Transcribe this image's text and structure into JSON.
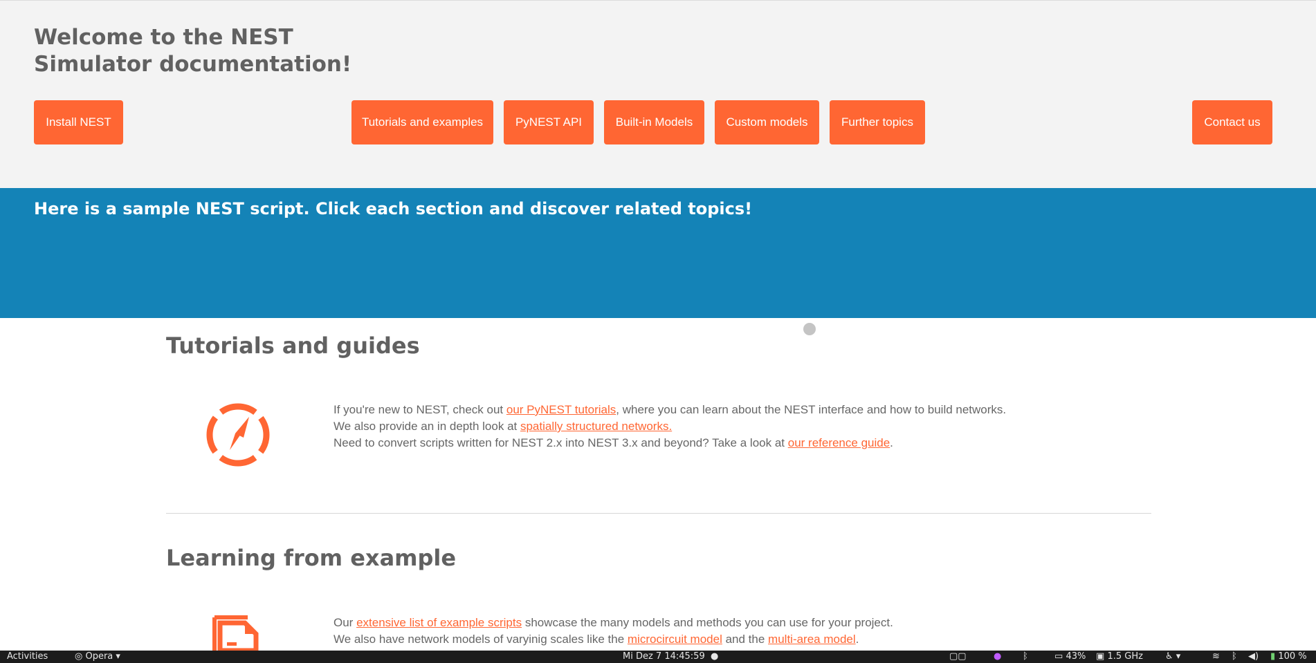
{
  "header": {
    "title": "Welcome to the NEST Simulator documentation!",
    "buttons": {
      "install": "Install NEST",
      "tutorials": "Tutorials and examples",
      "pynest": "PyNEST API",
      "builtin": "Built-in Models",
      "custom": "Custom models",
      "further": "Further topics",
      "contact": "Contact us"
    },
    "accent_color": "#ff6633"
  },
  "banner": {
    "text": "Here is a sample NEST script. Click each section and discover related topics!",
    "color": "#1483b7"
  },
  "sections": {
    "tutorials": {
      "title": "Tutorials and guides",
      "icon": "compass-icon",
      "line1": {
        "pre": "If you're new to NEST, check out ",
        "link": "our PyNEST tutorials",
        "post": ", where you can learn about the NEST interface and how to build networks."
      },
      "line2": {
        "pre": "We also provide an in depth look at ",
        "link": "spatially structured networks."
      },
      "line3": {
        "pre": "Need to convert scripts written for NEST 2.x into NEST 3.x and beyond? Take a look at ",
        "link": "our reference guide",
        "post": "."
      }
    },
    "examples": {
      "title": "Learning from example",
      "icon": "document-icon",
      "line1": {
        "pre": "Our ",
        "link": "extensive list of example scripts",
        "post": " showcase the many models and methods you can use for your project."
      },
      "line2": {
        "pre": "We also have network models of varyinig scales like the ",
        "link1": "microcircuit model",
        "mid": " and the ",
        "link2": "multi-area model",
        "post": "."
      }
    }
  },
  "taskbar": {
    "activities": "Activities",
    "app": "Opera",
    "datetime": "Mi Dez 7  14:45:59",
    "battery_text": "43%",
    "cpu": "1.5 GHz",
    "volume": "100 %"
  }
}
